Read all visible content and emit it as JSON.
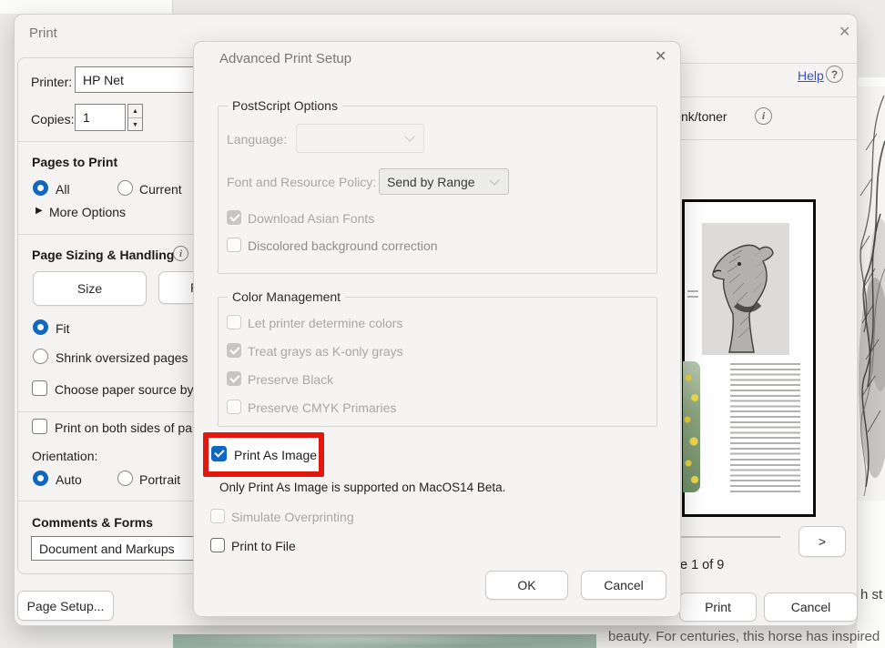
{
  "colors": {
    "accent_blue": "#1166c0",
    "highlight_red": "#e2180e",
    "link_blue": "#3a50c8",
    "dialog_bg": "#f4f3f1"
  },
  "icons": {
    "close": "✕",
    "help": "?",
    "info": "i",
    "more": "▶",
    "next": ">",
    "spin_up": "▲",
    "spin_down": "▼"
  },
  "background": {
    "bottom_text": "beauty. For centuries, this horse has inspired",
    "right_text_fragment": "h st"
  },
  "print_dialog": {
    "title": "Print",
    "help_label": "Help",
    "ink_toner_fragment": "nk/toner",
    "printer_label": "Printer:",
    "printer_value": "HP Net",
    "copies_label": "Copies:",
    "copies_value": "1",
    "pages_to_print": {
      "title": "Pages to Print",
      "all_label": "All",
      "all_selected": true,
      "current_label": "Current",
      "current_selected": false,
      "more_options_label": "More Options"
    },
    "page_sizing": {
      "title": "Page Sizing & Handling",
      "size_button": "Size",
      "poster_button_fragment": "P",
      "fit_label": "Fit",
      "fit_selected": true,
      "shrink_label": "Shrink oversized pages",
      "shrink_selected": false,
      "paper_source_label": "Choose paper source by PD",
      "paper_source_checked": false
    },
    "duplex": {
      "both_sides_label": "Print on both sides of pape",
      "both_sides_checked": false,
      "orientation_label": "Orientation:",
      "auto_label": "Auto",
      "auto_selected": true,
      "portrait_label": "Portrait",
      "portrait_selected": false
    },
    "comments_forms": {
      "title": "Comments & Forms",
      "value": "Document and Markups"
    },
    "page_setup_button": "Page Setup...",
    "preview": {
      "page_info_fragment": "e 1 of 9"
    },
    "print_button": "Print",
    "cancel_button": "Cancel"
  },
  "advanced_dialog": {
    "title": "Advanced Print Setup",
    "postscript": {
      "title": "PostScript Options",
      "language_label": "Language:",
      "language_value": "",
      "font_policy_label": "Font and Resource Policy:",
      "font_policy_value": "Send by Range",
      "download_asian_fonts_label": "Download Asian Fonts",
      "download_asian_fonts_checked": true,
      "discolored_label": "Discolored background correction",
      "discolored_checked": false
    },
    "color_management": {
      "title": "Color Management",
      "items": [
        {
          "label": "Let printer determine colors",
          "checked": false
        },
        {
          "label": "Treat grays as K-only grays",
          "checked": true
        },
        {
          "label": "Preserve Black",
          "checked": true
        },
        {
          "label": "Preserve CMYK Primaries",
          "checked": false
        }
      ]
    },
    "print_as_image_label": "Print As Image",
    "print_as_image_checked": true,
    "note": "Only Print As Image is supported on MacOS14 Beta.",
    "simulate_overprinting_label": "Simulate Overprinting",
    "simulate_overprinting_checked": false,
    "print_to_file_label": "Print to File",
    "print_to_file_checked": false,
    "ok_button": "OK",
    "cancel_button": "Cancel"
  }
}
